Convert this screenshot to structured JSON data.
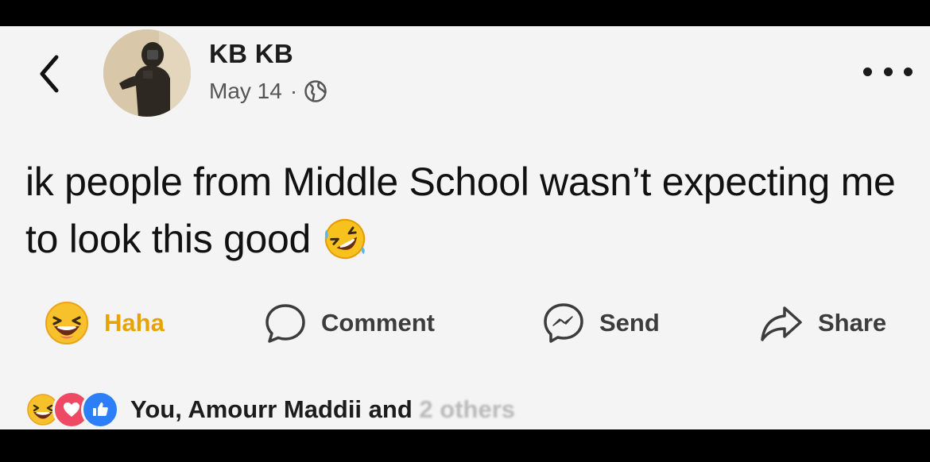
{
  "post": {
    "author": "KB KB",
    "date": "May 14",
    "separator": "·",
    "audience_icon": "globe-icon",
    "text": "ik people from Middle School wasn’t expecting me to look this good",
    "text_emoji": "rolling-on-floor-laughing-emoji"
  },
  "actions": {
    "reaction_label": "Haha",
    "comment_label": "Comment",
    "send_label": "Send",
    "share_label": "Share"
  },
  "reactions_summary": {
    "types": [
      "haha",
      "love",
      "like"
    ],
    "text": "You, Amourr Maddii and",
    "obscured_text": "2 others"
  },
  "colors": {
    "background": "#f4f4f4",
    "haha_yellow": "#e9a300",
    "love_red": "#ef4a63",
    "like_blue": "#2d7ff9"
  }
}
